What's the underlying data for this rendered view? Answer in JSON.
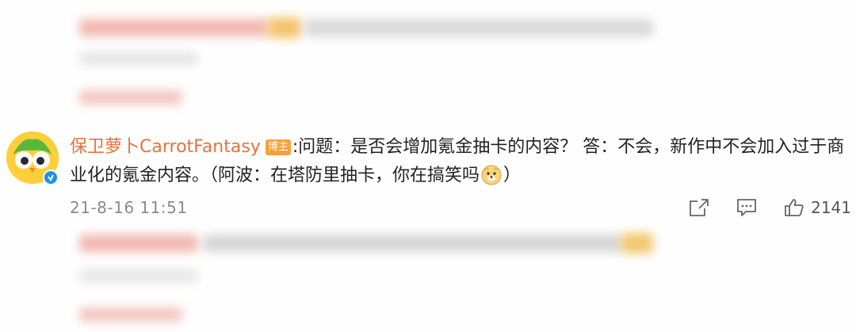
{
  "comment": {
    "username": "保卫萝卜CarrotFantasy",
    "badge": "博主",
    "text_part1": ":问题：是否会增加氪金抽卡的内容？ 答：不会，新作中不会加入过于商业化的氪金内容。（阿波：在塔防里抽卡，你在搞笑吗",
    "text_part2": "）",
    "emoji": "dog-face-emoji",
    "timestamp": "21-8-16 11:51",
    "like_count": "2141",
    "verified": true
  },
  "icons": {
    "share": "share-icon",
    "reply": "comment-icon",
    "like": "thumbs-up-icon"
  },
  "colors": {
    "username": "#e8723a",
    "badge_bg": "#f5a23a",
    "verified": "#1e90e6",
    "timestamp": "#8a8a8a"
  }
}
